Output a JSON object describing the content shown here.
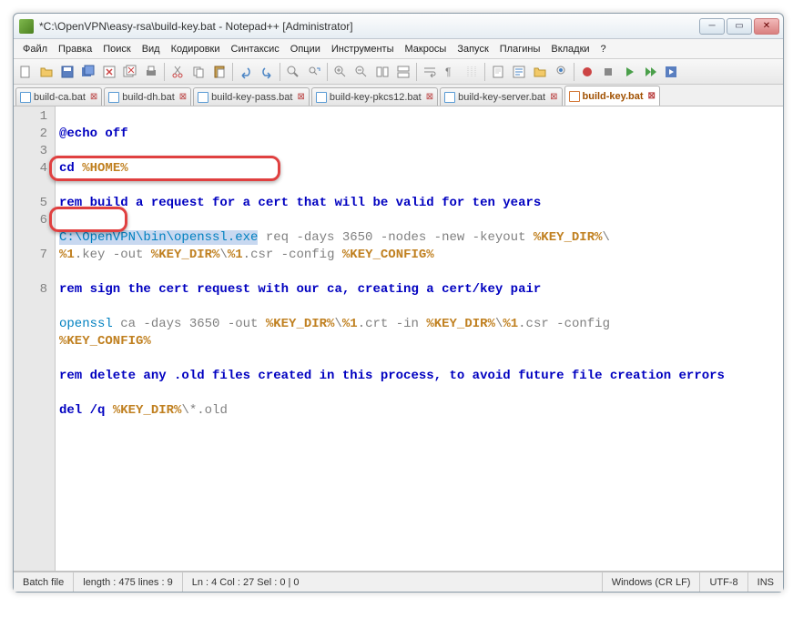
{
  "window": {
    "title": "*C:\\OpenVPN\\easy-rsa\\build-key.bat - Notepad++ [Administrator]"
  },
  "menu": {
    "file": "Файл",
    "edit": "Правка",
    "search": "Поиск",
    "view": "Вид",
    "encoding": "Кодировки",
    "syntax": "Синтаксис",
    "options": "Опции",
    "tools": "Инструменты",
    "macros": "Макросы",
    "run": "Запуск",
    "plugins": "Плагины",
    "tabs": "Вкладки",
    "help": "?"
  },
  "tabs": [
    {
      "label": "build-ca.bat"
    },
    {
      "label": "build-dh.bat"
    },
    {
      "label": "build-key-pass.bat"
    },
    {
      "label": "build-key-pkcs12.bat"
    },
    {
      "label": "build-key-server.bat"
    },
    {
      "label": "build-key.bat",
      "active": true
    }
  ],
  "code": {
    "l1": "@echo off",
    "l2a": "cd ",
    "l2b": "%HOME%",
    "l3": "rem build a request for a cert that will be valid for ten years",
    "l4sel": "C:\\OpenVPN\\bin\\openssl.exe",
    "l4a": " req -days 3650 -nodes -new -keyout ",
    "l4b": "%KEY_DIR%",
    "l4c": "\\",
    "l4d": "%1",
    "l4e": ".key -out ",
    "l4f": "%KEY_DIR%",
    "l4g": "\\",
    "l4h": "%1",
    "l4i": ".csr -config ",
    "l4j": "%KEY_CONFIG%",
    "l5": "rem sign the cert request with our ca, creating a cert/key pair",
    "l6a": "openssl",
    "l6b": " ca -days 3650 -out ",
    "l6c": "%KEY_DIR%",
    "l6d": "\\",
    "l6e": "%1",
    "l6f": ".crt -in ",
    "l6g": "%KEY_DIR%",
    "l6h": "\\",
    "l6i": "%1",
    "l6j": ".csr -config ",
    "l6k": "%KEY_CONFIG%",
    "l7": "rem delete any .old files created in this process, to avoid future file creation errors",
    "l8a": "del /q ",
    "l8b": "%KEY_DIR%",
    "l8c": "\\*.old"
  },
  "gutter": [
    "1",
    "2",
    "3",
    "4",
    "5",
    "6",
    "7",
    "8"
  ],
  "status": {
    "lang": "Batch file",
    "length": "length : 475     lines : 9",
    "pos": "Ln : 4   Col : 27   Sel : 0 | 0",
    "eol": "Windows (CR LF)",
    "enc": "UTF-8",
    "mode": "INS"
  },
  "colors": {
    "highlight": "#e04040"
  }
}
